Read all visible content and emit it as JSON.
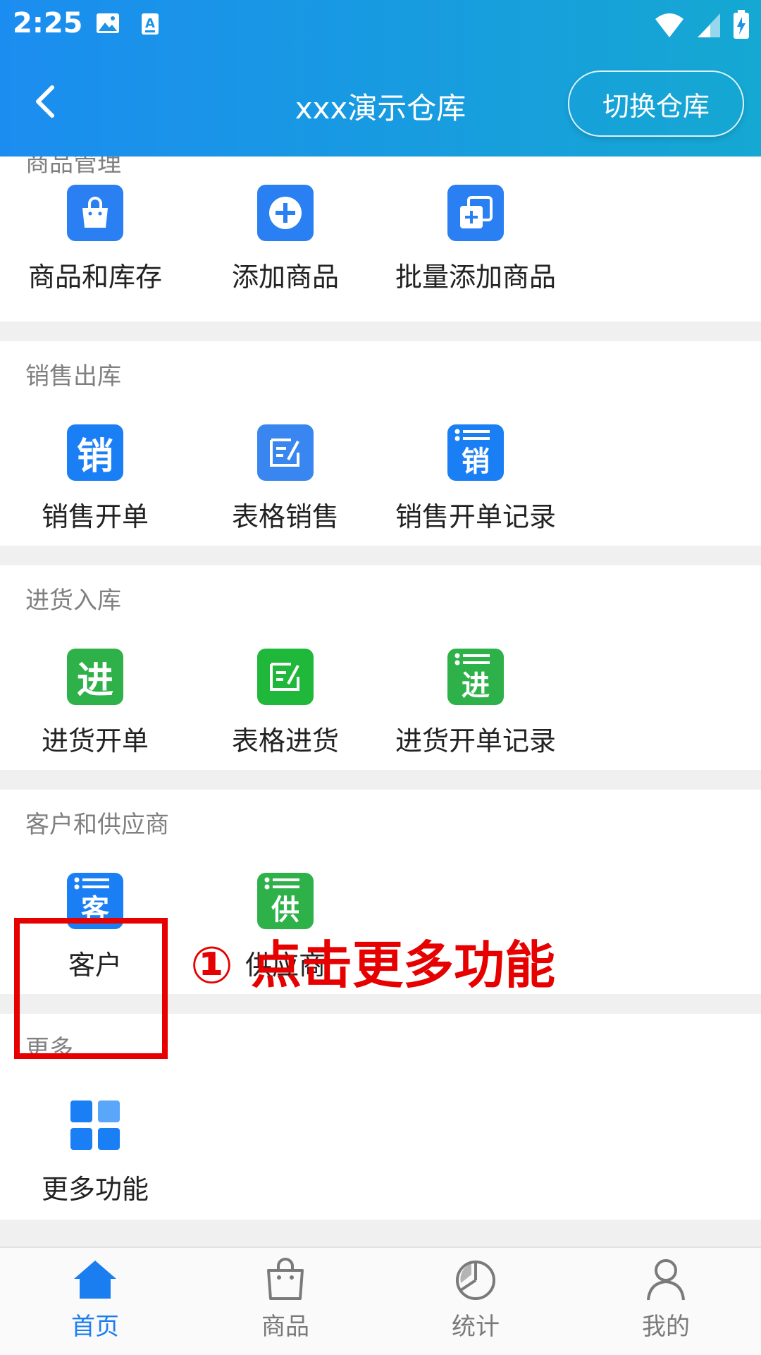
{
  "status": {
    "time": "2:25",
    "left_icons": [
      "image-icon",
      "text-icon"
    ],
    "right_icons": [
      "wifi-icon",
      "signal-icon",
      "battery-icon"
    ]
  },
  "header": {
    "title": "xxx演示仓库",
    "switch_label": "切换仓库"
  },
  "colors": {
    "primary": "#1b8df0",
    "blue_icon": "#2a7ff2",
    "green_icon": "#2fb14a",
    "accent_red": "#e60000",
    "tab_active": "#1b7ef0",
    "tab_inactive": "#7a7a7a"
  },
  "sections": [
    {
      "title": "商品管理",
      "items": [
        {
          "label": "商品和库存",
          "icon": "shopping-bag-icon"
        },
        {
          "label": "添加商品",
          "icon": "add-circle-icon"
        },
        {
          "label": "批量添加商品",
          "icon": "batch-add-icon"
        }
      ]
    },
    {
      "title": "销售出库",
      "items": [
        {
          "label": "销售开单",
          "icon": "sale-icon",
          "glyph": "销"
        },
        {
          "label": "表格销售",
          "icon": "edit-table-icon"
        },
        {
          "label": "销售开单记录",
          "icon": "sale-record-icon",
          "glyph": "销"
        }
      ]
    },
    {
      "title": "进货入库",
      "items": [
        {
          "label": "进货开单",
          "icon": "purchase-icon",
          "glyph": "进"
        },
        {
          "label": "表格进货",
          "icon": "edit-table-icon"
        },
        {
          "label": "进货开单记录",
          "icon": "purchase-record-icon",
          "glyph": "进"
        }
      ]
    },
    {
      "title": "客户和供应商",
      "items": [
        {
          "label": "客户",
          "icon": "customer-icon",
          "glyph": "客"
        },
        {
          "label": "供应商",
          "icon": "supplier-icon",
          "glyph": "供"
        }
      ]
    },
    {
      "title": "更多",
      "items": [
        {
          "label": "更多功能",
          "icon": "grid-icon"
        }
      ]
    }
  ],
  "annotation": "① 点击更多功能",
  "tabs": [
    {
      "label": "首页",
      "icon": "home-icon",
      "active": true
    },
    {
      "label": "商品",
      "icon": "bag-icon",
      "active": false
    },
    {
      "label": "统计",
      "icon": "pie-chart-icon",
      "active": false
    },
    {
      "label": "我的",
      "icon": "user-icon",
      "active": false
    }
  ]
}
